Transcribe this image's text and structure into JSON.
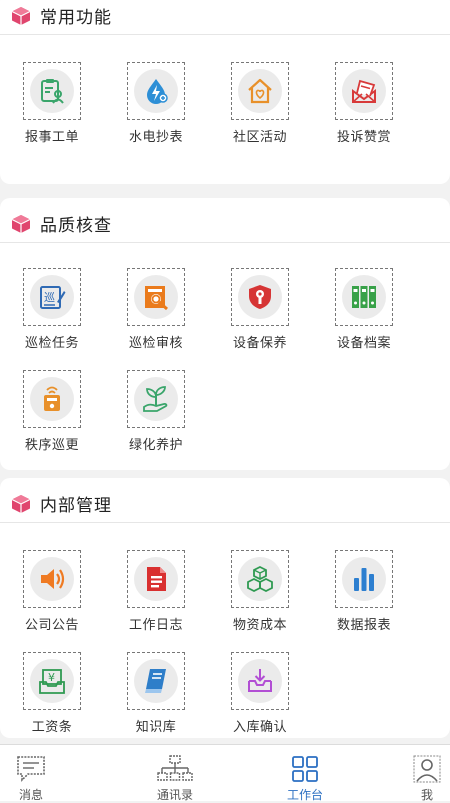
{
  "sections": [
    {
      "title": "常用功能",
      "items": [
        {
          "label": "报事工单",
          "icon": "clipboard-person-icon"
        },
        {
          "label": "水电抄表",
          "icon": "water-electric-drop-icon"
        },
        {
          "label": "社区活动",
          "icon": "house-heart-icon"
        },
        {
          "label": "投诉赞赏",
          "icon": "envelope-letter-icon"
        }
      ]
    },
    {
      "title": "品质核查",
      "items": [
        {
          "label": "巡检任务",
          "icon": "patrol-pen-icon",
          "glyph": "巡"
        },
        {
          "label": "巡检审核",
          "icon": "magnifier-doc-icon"
        },
        {
          "label": "设备保养",
          "icon": "shield-wrench-icon"
        },
        {
          "label": "设备档案",
          "icon": "binders-icon"
        },
        {
          "label": "秩序巡更",
          "icon": "patrol-device-icon"
        },
        {
          "label": "绿化养护",
          "icon": "plant-hand-icon"
        }
      ]
    },
    {
      "title": "内部管理",
      "items": [
        {
          "label": "公司公告",
          "icon": "speaker-icon"
        },
        {
          "label": "工作日志",
          "icon": "document-icon"
        },
        {
          "label": "物资成本",
          "icon": "cubes-icon"
        },
        {
          "label": "数据报表",
          "icon": "bar-chart-icon"
        },
        {
          "label": "工资条",
          "icon": "salary-yen-icon",
          "glyph": "¥"
        },
        {
          "label": "知识库",
          "icon": "book-icon"
        },
        {
          "label": "入库确认",
          "icon": "inbox-download-icon"
        }
      ]
    }
  ],
  "tabbar": {
    "items": [
      {
        "label": "消息",
        "icon": "chat-icon"
      },
      {
        "label": "通讯录",
        "icon": "org-chart-icon"
      },
      {
        "label": "工作台",
        "icon": "grid-icon",
        "active": true
      },
      {
        "label": "我",
        "icon": "person-icon"
      }
    ]
  },
  "colors": {
    "accent": "#2b6fc2",
    "section_icon": "#e0456e"
  }
}
